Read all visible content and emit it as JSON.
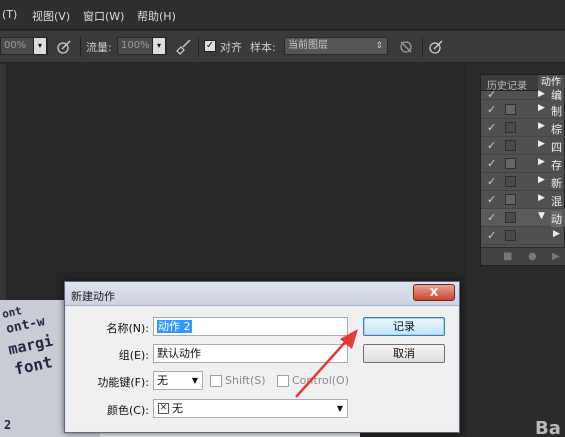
{
  "menubar": {
    "items": [
      "(T)",
      "视图(V)",
      "窗口(W)",
      "帮助(H)"
    ]
  },
  "options": {
    "opacity_value": "00%",
    "flow_label": "流量:",
    "flow_value": "100%",
    "align_label": "对齐",
    "sample_label": "样本:",
    "sample_value": "当前图层"
  },
  "panel": {
    "tab_history": "历史记录",
    "tab_actions": "动作",
    "rows": [
      "编",
      "制",
      "棕",
      "四",
      "存",
      "新",
      "混",
      "动",
      ""
    ]
  },
  "dialog": {
    "title": "新建动作",
    "close": "X",
    "name_label": "名称(N):",
    "name_value": "动作 2",
    "set_label": "组(E):",
    "set_value": "默认动作",
    "fkey_label": "功能键(F):",
    "fkey_value": "无",
    "shift_label": "Shift(S)",
    "control_label": "Control(O)",
    "color_label": "颜色(C):",
    "color_value": "无",
    "record_button": "记录",
    "cancel_button": "取消"
  },
  "canvas": {
    "photo_text": [
      "ont-w",
      "margi",
      "font",
      "ont",
      "2"
    ],
    "brand_text": "Ba"
  },
  "colors": {
    "arrow": "#e53935",
    "selection": "#3399ff"
  }
}
